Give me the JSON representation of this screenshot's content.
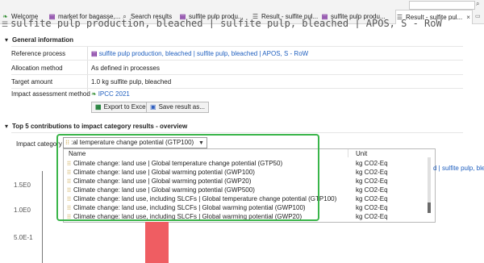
{
  "tabs": [
    {
      "label": "Welcome",
      "icon": "leaf-icon"
    },
    {
      "label": "market for bagasse,...",
      "icon": "process-icon"
    },
    {
      "label": "Search results",
      "icon": "search-icon"
    },
    {
      "label": "sulfite pulp produ...",
      "icon": "process-icon"
    },
    {
      "label": "Result - sulfite pul...",
      "icon": "result-icon"
    },
    {
      "label": "sulfite pulp produ...",
      "icon": "process-icon"
    },
    {
      "label": "Result - sulfite pul...",
      "icon": "result-icon",
      "active": true,
      "close": "×"
    }
  ],
  "title_line": "sulfite pulp production, bleached | sulfite pulp, bleached | APOS, S - RoW",
  "general": {
    "heading": "General information",
    "reference_process_label": "Reference process",
    "reference_process_value": "sulfite pulp production, bleached | sulfite pulp, bleached | APOS, S - RoW",
    "allocation_label": "Allocation method",
    "allocation_value": "As defined in processes",
    "target_label": "Target amount",
    "target_value": "1.0 kg sulfite pulp, bleached",
    "impact_label": "Impact assessment method",
    "impact_value": "IPCC 2021",
    "export_button": "Export to Excel",
    "save_button": "Save result as..."
  },
  "top5": {
    "heading": "Top 5 contributions to impact category results - overview",
    "impact_category_label": "Impact category",
    "selected": ":al temperature change potential (GTP100)",
    "columns": {
      "name": "Name",
      "unit": "Unit"
    },
    "options": [
      {
        "name": "Climate change: land use | Global temperature change potential (GTP50)",
        "unit": "kg CO2-Eq"
      },
      {
        "name": "Climate change: land use | Global warming potential (GWP100)",
        "unit": "kg CO2-Eq"
      },
      {
        "name": "Climate change: land use | Global warming potential (GWP20)",
        "unit": "kg CO2-Eq"
      },
      {
        "name": "Climate change: land use | Global warming potential (GWP500)",
        "unit": "kg CO2-Eq"
      },
      {
        "name": "Climate change: land use, including SLCFs | Global temperature change potential (GTP100)",
        "unit": "kg CO2-Eq"
      },
      {
        "name": "Climate change: land use, including SLCFs | Global warming potential (GWP100)",
        "unit": "kg CO2-Eq"
      },
      {
        "name": "Climate change: land use, including SLCFs | Global warming potential (GWP20)",
        "unit": "kg CO2-Eq"
      }
    ],
    "behind_text": "d | sulfite pulp, blea",
    "y_ticks": [
      "1.5E0",
      "1.0E0",
      "5.0E-1"
    ]
  },
  "colors": {
    "highlight": "#3ab54a",
    "bar": "#ef5d62",
    "link": "#1f5fbf"
  }
}
